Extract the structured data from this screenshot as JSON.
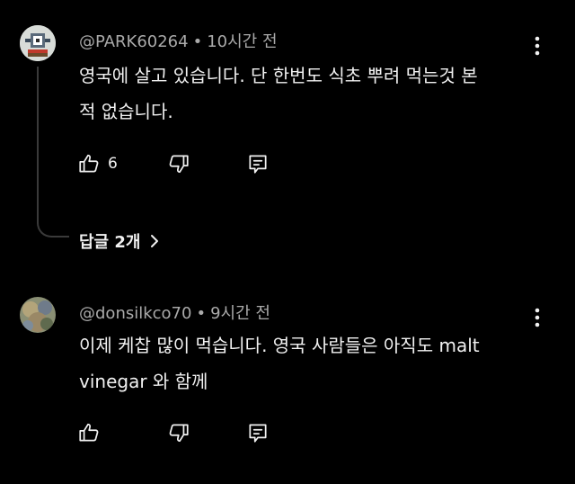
{
  "comments": [
    {
      "username": "@PARK60264",
      "time": "10시간 전",
      "text_line1": "영국에 살고 있습니다. 단 한번도 식초 뿌려 먹는것 본",
      "text_line2": "적 없습니다.",
      "likes": "6",
      "avatar_icon": "pixel-art-avatar",
      "replies_label": "답글 2개"
    },
    {
      "username": "@donsilkco70",
      "time": "9시간 전",
      "text_line1": "이제 케찹 많이 먹습니다. 영국 사람들은 아직도 malt",
      "text_line2": "vinegar 와 함께",
      "avatar_icon": "photo-avatar"
    }
  ],
  "separator": "•",
  "icons": {
    "like": "thumbs-up-icon",
    "dislike": "thumbs-down-icon",
    "reply": "reply-icon",
    "more": "more-vert-icon",
    "chevron": "chevron-right-icon"
  },
  "colors": {
    "background": "#000000",
    "text": "#f1f1f1",
    "secondary": "#aaaaaa",
    "thread_line": "#3a3a3a"
  }
}
